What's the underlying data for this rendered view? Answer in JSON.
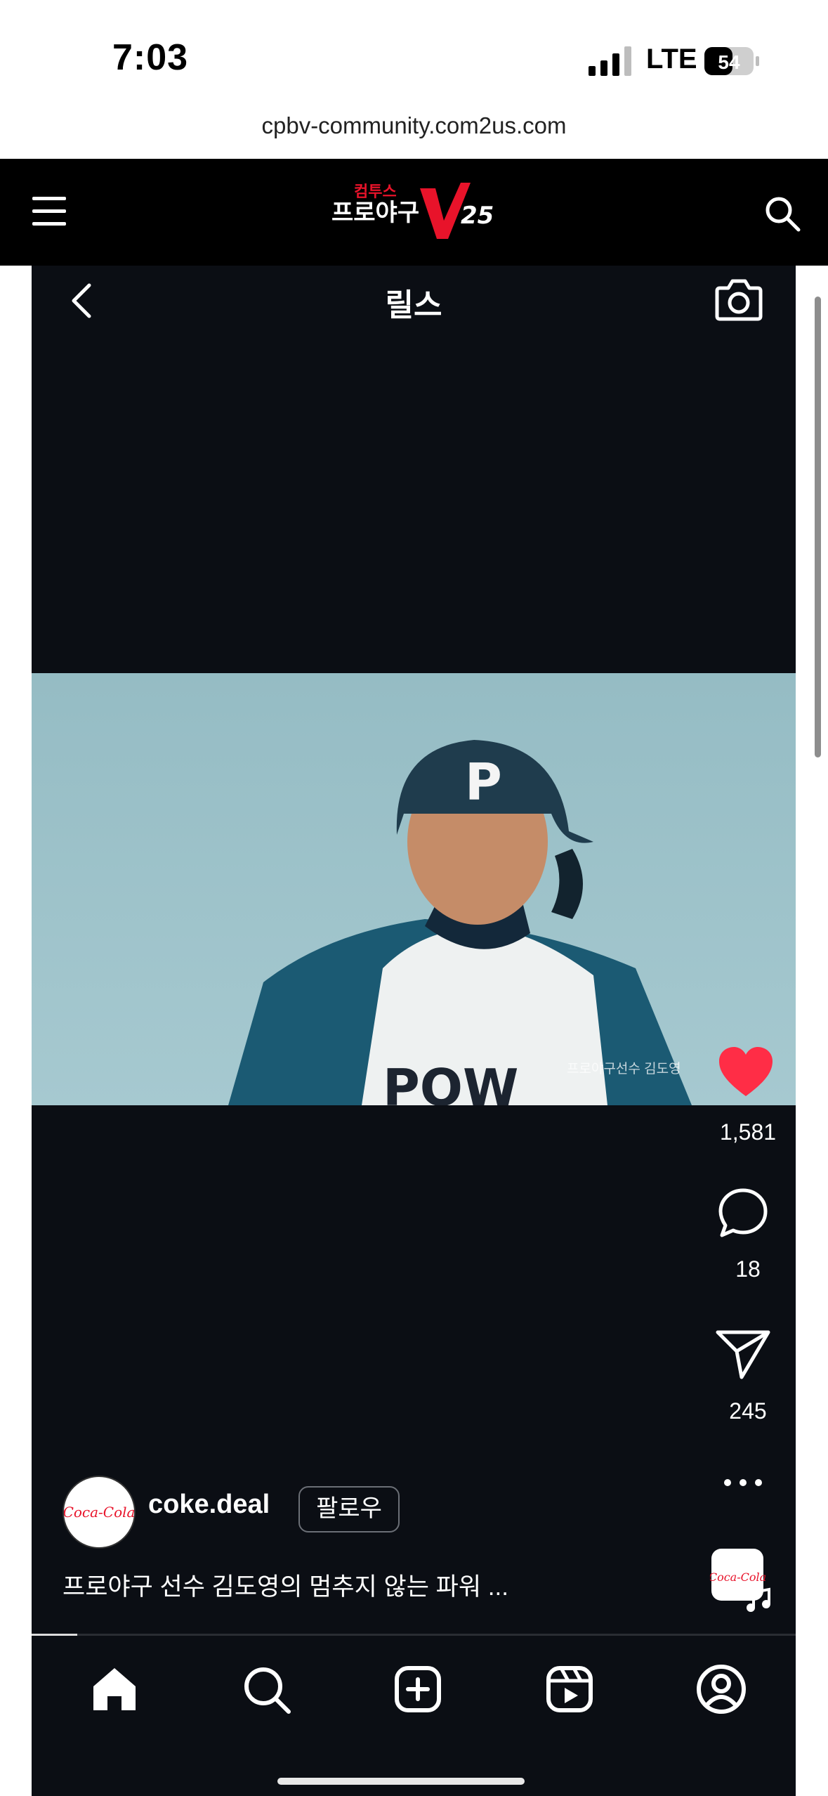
{
  "status_bar": {
    "time": "7:03",
    "network": "LTE",
    "battery": "54"
  },
  "browser": {
    "url": "cpbv-community.com2us.com"
  },
  "site_header": {
    "logo_top": "컴투스",
    "logo_main": "프로야구",
    "logo_mark": "V",
    "logo_num": "25"
  },
  "reels": {
    "title": "릴스",
    "watermark": "프로야구선수 김도영",
    "likes": "1,581",
    "comments": "18",
    "shares": "245",
    "username": "coke.deal",
    "follow_label": "팔로우",
    "caption": "프로야구 선수 김도영의 멈추지 않는 파워 ...",
    "progress": 0.06,
    "avatar_logo": "Coca-Cola"
  },
  "colors": {
    "header_bg": "#000000",
    "app_bg": "#0b0e14",
    "like": "#ff2d46",
    "logo_red": "#e8132a"
  },
  "bottom_nav": [
    "home-icon",
    "search-icon",
    "create-icon",
    "reels-icon",
    "profile-icon"
  ]
}
